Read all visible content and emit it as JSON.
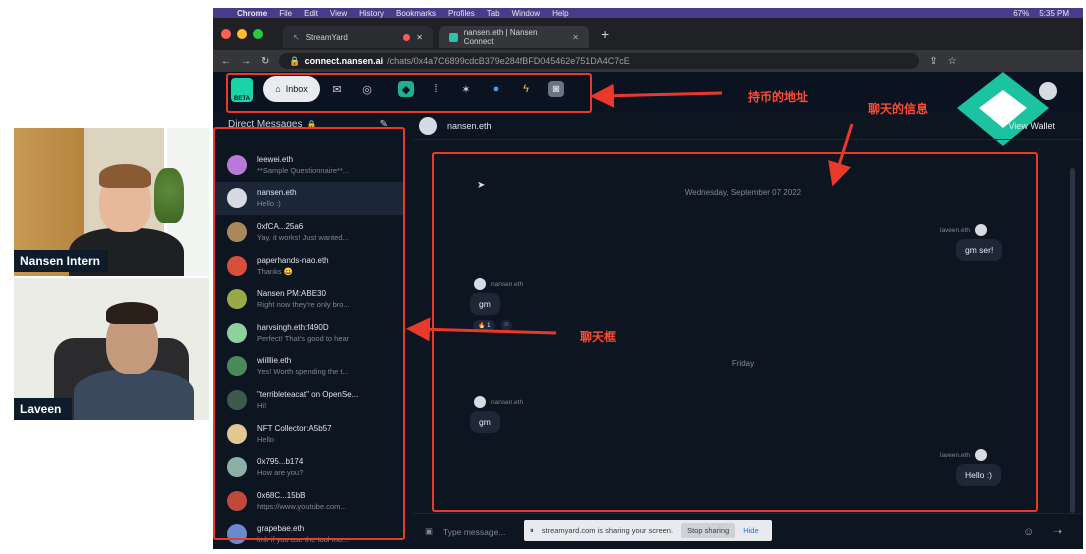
{
  "cameras": [
    {
      "name": "Nansen Intern"
    },
    {
      "name": "Laveen"
    }
  ],
  "browser": {
    "menubar": {
      "app": "Chrome",
      "items": [
        "File",
        "Edit",
        "View",
        "History",
        "Bookmarks",
        "Profiles",
        "Tab",
        "Window",
        "Help"
      ],
      "battery": "67%",
      "time": "5:35 PM"
    },
    "tabs": [
      {
        "label": "StreamYard"
      },
      {
        "label": "nansen.eth | Nansen Connect"
      }
    ],
    "url": {
      "host": "connect.nansen.ai",
      "path": "/chats/0x4a7C6899cdcB379e284fBFD045462e751DA4C7cE"
    }
  },
  "app": {
    "logo_badge": "BETA",
    "inbox_label": "Inbox",
    "direct_messages_label": "Direct Messages",
    "chat_header": {
      "name": "nansen.eth",
      "view_wallet": "View Wallet"
    },
    "dms": [
      {
        "name": "leewei.eth",
        "preview": "**Sample Questionnaire**...",
        "color": "#b87ad8"
      },
      {
        "name": "nansen.eth",
        "preview": "Hello :)",
        "color": "#d6dbe2"
      },
      {
        "name": "0xfCA...25a6",
        "preview": "Yay, it works! Just wanted...",
        "color": "#a88a5a"
      },
      {
        "name": "paperhands-nao.eth",
        "preview": "Thanks 😀",
        "color": "#d94f3d"
      },
      {
        "name": "Nansen PM:ABE30",
        "preview": "Right now they're only bro...",
        "color": "#9aa84a"
      },
      {
        "name": "harvsingh.eth:f490D",
        "preview": "Perfect! That's good to hear",
        "color": "#8fcfa0"
      },
      {
        "name": "wiilllie.eth",
        "preview": "Yes! Worth spending the t...",
        "color": "#4a8a5a"
      },
      {
        "name": "\"terribleteacat\" on OpenSe...",
        "preview": "Hi!",
        "color": "#3f5a4a"
      },
      {
        "name": "NFT Collector:A5b57",
        "preview": "Hello",
        "color": "#e0c890"
      },
      {
        "name": "0x795...b174",
        "preview": "How are you?",
        "color": "#8ab0a8"
      },
      {
        "name": "0x68C...15bB",
        "preview": "https://www.youtube.com...",
        "color": "#c04a3a"
      },
      {
        "name": "grapebae.eth",
        "preview": "lmk if you use the tool mo...",
        "color": "#6a8ad0"
      }
    ],
    "chat": {
      "date1": "Wednesday, September 07 2022",
      "date2": "Friday",
      "messages": [
        {
          "sender": "laveen.eth",
          "text": "gm ser!"
        },
        {
          "sender": "nansen.eth",
          "text": "gm",
          "reaction": "🔥 1"
        },
        {
          "sender": "nansen.eth",
          "text": "gm"
        },
        {
          "sender": "laveen.eth",
          "text": "Hello :)"
        }
      ]
    },
    "composer": {
      "placeholder": "Type message...",
      "share_notice": "streamyard.com is sharing your screen.",
      "stop_sharing": "Stop sharing",
      "hide": "Hide"
    }
  },
  "annotations": {
    "wallet_addresses": "持币的地址",
    "chat_messages": "聊天的信息",
    "chat_box": "聊天框",
    "color": "#e8392b"
  }
}
